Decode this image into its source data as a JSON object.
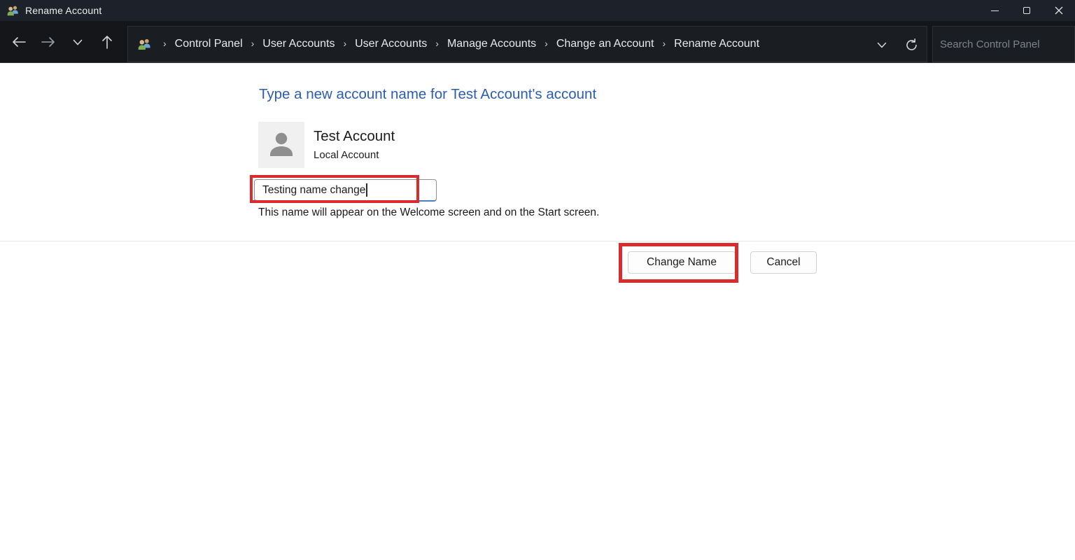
{
  "window": {
    "title": "Rename Account"
  },
  "navbar": {
    "breadcrumb": [
      "Control Panel",
      "User Accounts",
      "User Accounts",
      "Manage Accounts",
      "Change an Account",
      "Rename Account"
    ],
    "separator": "›",
    "search_placeholder": "Search Control Panel"
  },
  "main": {
    "heading": "Type a new account name for Test Account's account",
    "account": {
      "name": "Test Account",
      "type": "Local Account"
    },
    "name_input": {
      "value": "Testing name change"
    },
    "help_text": "This name will appear on the Welcome screen and on the Start screen.",
    "buttons": {
      "change_name": "Change Name",
      "cancel": "Cancel"
    }
  },
  "icons": [
    "user-accounts-icon",
    "minimize-icon",
    "maximize-icon",
    "close-icon",
    "back-icon",
    "forward-icon",
    "recent-pages-chevron-icon",
    "up-icon",
    "breadcrumb-user-accounts-icon",
    "address-dropdown-chevron-icon",
    "refresh-icon",
    "search-icon",
    "avatar-person-icon",
    "text-caret"
  ],
  "colors": {
    "titlebar_bg": "#1d222a",
    "navbar_bg": "#141619",
    "address_bg": "#1a1e22",
    "heading_blue": "#2a5db2",
    "annotation_red": "#d92c2c",
    "input_focus_underline": "#4a7fc1"
  }
}
